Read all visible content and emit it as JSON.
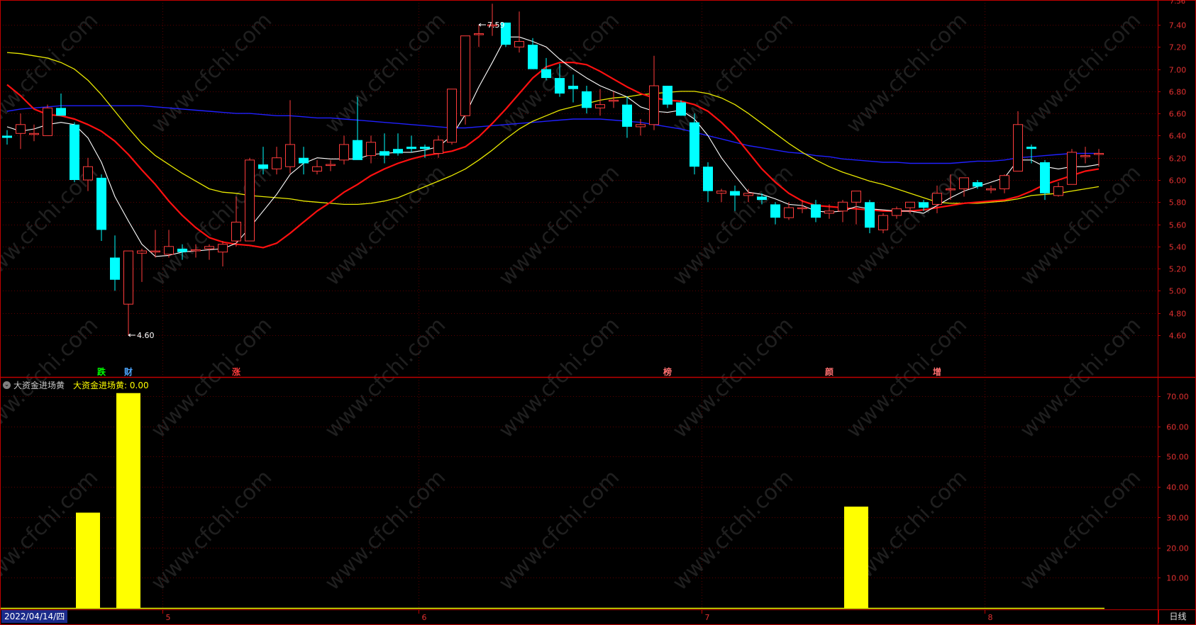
{
  "colors": {
    "up": "#ff3c3c",
    "down": "#00ffff",
    "ma5": "#ffffff",
    "ma10": "#ff1010",
    "ma20": "#e8e800",
    "ma60": "#2020ff",
    "bar": "#ffff00",
    "axis": "#c00000",
    "grid": "#5a0000"
  },
  "indicator": {
    "name": "大资金进场黄",
    "value_label": "大资金进场黄: 0.00"
  },
  "footer": {
    "date": "2022/04/14/四",
    "period": "日线"
  },
  "chart_data": [
    {
      "type": "candlestick",
      "ylim": [
        4.45,
        7.65
      ],
      "yticks": [
        "7.40",
        "7.20",
        "7.00",
        "6.80",
        "6.60",
        "6.40",
        "6.20",
        "6.00",
        "5.80",
        "5.60",
        "5.40",
        "5.20",
        "5.00",
        "4.80",
        "4.60"
      ],
      "top_partial_tick": "7.56",
      "xticks": [
        {
          "label": "5",
          "index": 12
        },
        {
          "label": "6",
          "index": 31
        },
        {
          "label": "7",
          "index": 52
        },
        {
          "label": "8",
          "index": 73
        }
      ],
      "annotations": [
        {
          "text": "7.59",
          "index": 35
        },
        {
          "text": "4.60",
          "index": 9
        }
      ],
      "markers": [
        {
          "text": "跌",
          "index": 7,
          "color": "#00ff00"
        },
        {
          "text": "财",
          "index": 9,
          "color": "#4da6ff"
        },
        {
          "text": "涨",
          "index": 17,
          "color": "#ff3c3c"
        },
        {
          "text": "榜",
          "index": 49,
          "color": "#ff7070"
        },
        {
          "text": "颜",
          "index": 61,
          "color": "#ff7070"
        },
        {
          "text": "增",
          "index": 69,
          "color": "#ff7070"
        }
      ],
      "ohlc": [
        [
          6.4,
          6.45,
          6.32,
          6.38
        ],
        [
          6.42,
          6.6,
          6.28,
          6.5
        ],
        [
          6.42,
          6.5,
          6.35,
          6.42
        ],
        [
          6.4,
          6.68,
          6.4,
          6.65
        ],
        [
          6.65,
          6.78,
          6.58,
          6.58
        ],
        [
          6.5,
          6.52,
          5.98,
          6.0
        ],
        [
          6.0,
          6.2,
          5.9,
          6.12
        ],
        [
          6.02,
          6.05,
          5.45,
          5.55
        ],
        [
          5.3,
          5.5,
          5.0,
          5.1
        ],
        [
          4.88,
          5.36,
          4.6,
          5.36
        ],
        [
          5.34,
          5.38,
          5.08,
          5.36
        ],
        [
          5.36,
          5.55,
          5.3,
          5.36
        ],
        [
          5.33,
          5.55,
          5.3,
          5.4
        ],
        [
          5.38,
          5.42,
          5.28,
          5.35
        ],
        [
          5.37,
          5.42,
          5.3,
          5.37
        ],
        [
          5.38,
          5.42,
          5.28,
          5.4
        ],
        [
          5.35,
          5.45,
          5.22,
          5.42
        ],
        [
          5.45,
          5.85,
          5.4,
          5.62
        ],
        [
          5.45,
          6.2,
          5.45,
          6.18
        ],
        [
          6.14,
          6.3,
          6.05,
          6.1
        ],
        [
          6.1,
          6.3,
          6.05,
          6.2
        ],
        [
          6.12,
          6.72,
          6.06,
          6.32
        ],
        [
          6.2,
          6.3,
          6.05,
          6.15
        ],
        [
          6.08,
          6.18,
          6.05,
          6.12
        ],
        [
          6.14,
          6.18,
          6.08,
          6.14
        ],
        [
          6.18,
          6.4,
          6.14,
          6.32
        ],
        [
          6.36,
          6.75,
          6.2,
          6.18
        ],
        [
          6.22,
          6.4,
          6.15,
          6.34
        ],
        [
          6.26,
          6.42,
          6.15,
          6.22
        ],
        [
          6.28,
          6.42,
          6.22,
          6.24
        ],
        [
          6.3,
          6.4,
          6.25,
          6.28
        ],
        [
          6.3,
          6.32,
          6.2,
          6.28
        ],
        [
          6.24,
          6.4,
          6.2,
          6.36
        ],
        [
          6.34,
          6.82,
          6.32,
          6.82
        ],
        [
          6.58,
          7.3,
          6.5,
          7.3
        ],
        [
          7.32,
          7.4,
          7.2,
          7.32
        ],
        [
          7.4,
          7.59,
          7.3,
          7.4
        ],
        [
          7.42,
          7.42,
          7.2,
          7.22
        ],
        [
          7.2,
          7.52,
          7.15,
          7.25
        ],
        [
          7.22,
          7.28,
          7.0,
          7.0
        ],
        [
          7.0,
          7.1,
          6.9,
          6.92
        ],
        [
          6.92,
          7.05,
          6.75,
          6.78
        ],
        [
          6.85,
          6.95,
          6.7,
          6.82
        ],
        [
          6.8,
          6.85,
          6.6,
          6.65
        ],
        [
          6.65,
          6.82,
          6.58,
          6.68
        ],
        [
          6.72,
          6.8,
          6.65,
          6.72
        ],
        [
          6.68,
          6.75,
          6.38,
          6.48
        ],
        [
          6.48,
          6.55,
          6.4,
          6.5
        ],
        [
          6.5,
          7.12,
          6.45,
          6.85
        ],
        [
          6.85,
          6.85,
          6.65,
          6.68
        ],
        [
          6.7,
          6.72,
          6.58,
          6.58
        ],
        [
          6.52,
          6.6,
          6.05,
          6.12
        ],
        [
          6.12,
          6.16,
          5.8,
          5.9
        ],
        [
          5.88,
          5.92,
          5.8,
          5.9
        ],
        [
          5.9,
          5.95,
          5.72,
          5.86
        ],
        [
          5.86,
          5.92,
          5.8,
          5.88
        ],
        [
          5.85,
          5.88,
          5.78,
          5.82
        ],
        [
          5.78,
          5.8,
          5.6,
          5.66
        ],
        [
          5.66,
          5.8,
          5.64,
          5.75
        ],
        [
          5.75,
          5.82,
          5.7,
          5.75
        ],
        [
          5.78,
          5.82,
          5.62,
          5.66
        ],
        [
          5.7,
          5.78,
          5.65,
          5.72
        ],
        [
          5.72,
          5.82,
          5.62,
          5.8
        ],
        [
          5.8,
          5.9,
          5.6,
          5.9
        ],
        [
          5.8,
          5.82,
          5.52,
          5.57
        ],
        [
          5.55,
          5.7,
          5.52,
          5.68
        ],
        [
          5.68,
          5.76,
          5.65,
          5.74
        ],
        [
          5.75,
          5.8,
          5.7,
          5.8
        ],
        [
          5.8,
          5.82,
          5.72,
          5.75
        ],
        [
          5.78,
          5.95,
          5.7,
          5.88
        ],
        [
          5.92,
          6.05,
          5.82,
          5.92
        ],
        [
          5.92,
          6.0,
          5.85,
          6.02
        ],
        [
          5.98,
          6.0,
          5.92,
          5.94
        ],
        [
          5.92,
          5.95,
          5.88,
          5.92
        ],
        [
          5.92,
          6.05,
          5.88,
          6.04
        ],
        [
          6.08,
          6.62,
          6.08,
          6.5
        ],
        [
          6.3,
          6.32,
          6.15,
          6.28
        ],
        [
          6.16,
          6.18,
          5.82,
          5.88
        ],
        [
          5.86,
          5.98,
          5.85,
          5.94
        ],
        [
          5.96,
          6.28,
          5.96,
          6.25
        ],
        [
          6.22,
          6.3,
          6.15,
          6.22
        ],
        [
          6.24,
          6.28,
          6.12,
          6.24
        ]
      ],
      "ma5": [
        6.48,
        6.44,
        6.46,
        6.5,
        6.52,
        6.5,
        6.38,
        6.16,
        5.85,
        5.63,
        5.42,
        5.31,
        5.32,
        5.35,
        5.36,
        5.37,
        5.38,
        5.43,
        5.57,
        5.72,
        5.87,
        6.05,
        6.15,
        6.2,
        6.19,
        6.19,
        6.19,
        6.23,
        6.24,
        6.25,
        6.25,
        6.27,
        6.3,
        6.4,
        6.59,
        6.84,
        7.06,
        7.29,
        7.29,
        7.25,
        7.2,
        7.09,
        7.0,
        6.92,
        6.85,
        6.8,
        6.75,
        6.66,
        6.62,
        6.61,
        6.63,
        6.55,
        6.4,
        6.2,
        6.04,
        5.89,
        5.87,
        5.83,
        5.78,
        5.77,
        5.72,
        5.71,
        5.72,
        5.76,
        5.74,
        5.73,
        5.72,
        5.72,
        5.7,
        5.77,
        5.84,
        5.9,
        5.94,
        5.98,
        6.02,
        6.18,
        6.18,
        6.12,
        6.1,
        6.12,
        6.12,
        6.14
      ],
      "ma10": [
        6.86,
        6.76,
        6.64,
        6.59,
        6.58,
        6.55,
        6.5,
        6.44,
        6.35,
        6.23,
        6.09,
        5.96,
        5.81,
        5.68,
        5.57,
        5.48,
        5.44,
        5.42,
        5.41,
        5.39,
        5.43,
        5.52,
        5.62,
        5.72,
        5.8,
        5.89,
        5.96,
        6.04,
        6.1,
        6.15,
        6.19,
        6.22,
        6.24,
        6.26,
        6.3,
        6.39,
        6.51,
        6.64,
        6.78,
        6.92,
        7.02,
        7.06,
        7.06,
        7.04,
        6.98,
        6.91,
        6.84,
        6.78,
        6.74,
        6.72,
        6.71,
        6.68,
        6.62,
        6.52,
        6.4,
        6.25,
        6.1,
        5.98,
        5.88,
        5.81,
        5.77,
        5.76,
        5.75,
        5.74,
        5.73,
        5.72,
        5.72,
        5.72,
        5.73,
        5.75,
        5.77,
        5.79,
        5.8,
        5.81,
        5.82,
        5.85,
        5.9,
        5.96,
        6.0,
        6.04,
        6.08,
        6.1
      ],
      "ma20": [
        7.15,
        7.14,
        7.12,
        7.1,
        7.06,
        7.0,
        6.9,
        6.77,
        6.62,
        6.47,
        6.33,
        6.22,
        6.14,
        6.06,
        5.99,
        5.92,
        5.89,
        5.88,
        5.86,
        5.85,
        5.84,
        5.83,
        5.81,
        5.8,
        5.79,
        5.78,
        5.78,
        5.79,
        5.81,
        5.84,
        5.89,
        5.94,
        5.99,
        6.04,
        6.1,
        6.18,
        6.27,
        6.37,
        6.46,
        6.53,
        6.58,
        6.63,
        6.66,
        6.69,
        6.72,
        6.74,
        6.75,
        6.77,
        6.78,
        6.79,
        6.8,
        6.8,
        6.78,
        6.74,
        6.68,
        6.6,
        6.51,
        6.42,
        6.33,
        6.25,
        6.18,
        6.12,
        6.07,
        6.03,
        5.99,
        5.96,
        5.92,
        5.88,
        5.84,
        5.8,
        5.79,
        5.79,
        5.79,
        5.8,
        5.81,
        5.83,
        5.86,
        5.87,
        5.88,
        5.9,
        5.92,
        5.94
      ],
      "ma60": [
        6.62,
        6.64,
        6.65,
        6.66,
        6.67,
        6.67,
        6.67,
        6.67,
        6.67,
        6.67,
        6.67,
        6.66,
        6.65,
        6.64,
        6.63,
        6.62,
        6.61,
        6.6,
        6.6,
        6.59,
        6.58,
        6.58,
        6.57,
        6.56,
        6.56,
        6.55,
        6.54,
        6.53,
        6.52,
        6.51,
        6.5,
        6.49,
        6.48,
        6.47,
        6.47,
        6.48,
        6.49,
        6.5,
        6.51,
        6.52,
        6.53,
        6.54,
        6.55,
        6.55,
        6.55,
        6.54,
        6.53,
        6.52,
        6.5,
        6.48,
        6.46,
        6.43,
        6.4,
        6.37,
        6.34,
        6.31,
        6.29,
        6.27,
        6.25,
        6.24,
        6.22,
        6.21,
        6.19,
        6.18,
        6.17,
        6.16,
        6.16,
        6.15,
        6.15,
        6.15,
        6.15,
        6.16,
        6.17,
        6.17,
        6.18,
        6.2,
        6.21,
        6.22,
        6.23,
        6.24,
        6.24,
        6.24
      ]
    },
    {
      "type": "bar",
      "title": "大资金进场黄",
      "ylim": [
        0,
        75
      ],
      "yticks": [
        "70.00",
        "60.00",
        "50.00",
        "40.00",
        "30.00",
        "20.00",
        "10.00"
      ],
      "bars": [
        {
          "index": 6,
          "value": 31.5
        },
        {
          "index": 9,
          "value": 71.0
        },
        {
          "index": 63,
          "value": 33.5
        }
      ]
    }
  ]
}
